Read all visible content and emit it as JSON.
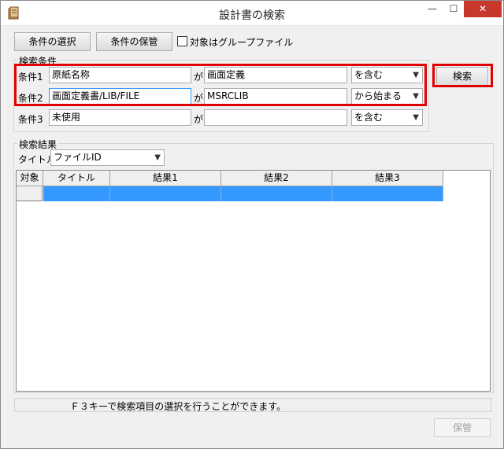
{
  "window": {
    "title": "設計書の検索",
    "minimize": "—",
    "maximize": "☐",
    "close": "✕"
  },
  "toolbar": {
    "select_conditions": "条件の選択",
    "save_conditions": "条件の保管",
    "group_file_checkbox": {
      "label": "対象はグループファイル",
      "checked": false
    }
  },
  "search_conditions": {
    "legend": "検索条件",
    "rows": [
      {
        "label": "条件1",
        "field": "原紙名称",
        "connector": "が",
        "value": "画面定義",
        "operator": "を含む"
      },
      {
        "label": "条件2",
        "field": "画面定義書/LIB/FILE",
        "connector": "が",
        "value": "MSRCLIB",
        "operator": "から始まる"
      },
      {
        "label": "条件3",
        "field": "未使用",
        "connector": "が",
        "value": "",
        "operator": "を含む"
      }
    ]
  },
  "search_button": "検索",
  "results": {
    "legend": "検索結果",
    "title_label": "タイトル",
    "title_select": "ファイルID",
    "columns": [
      "対象",
      "タイトル",
      "結果1",
      "結果2",
      "結果3"
    ]
  },
  "status": "Ｆ３キーで検索項目の選択を行うことができます。",
  "save_button": "保管",
  "colors": {
    "highlight_frame": "#e00000",
    "selected_row": "#3399ff",
    "close_button": "#c7372c"
  }
}
